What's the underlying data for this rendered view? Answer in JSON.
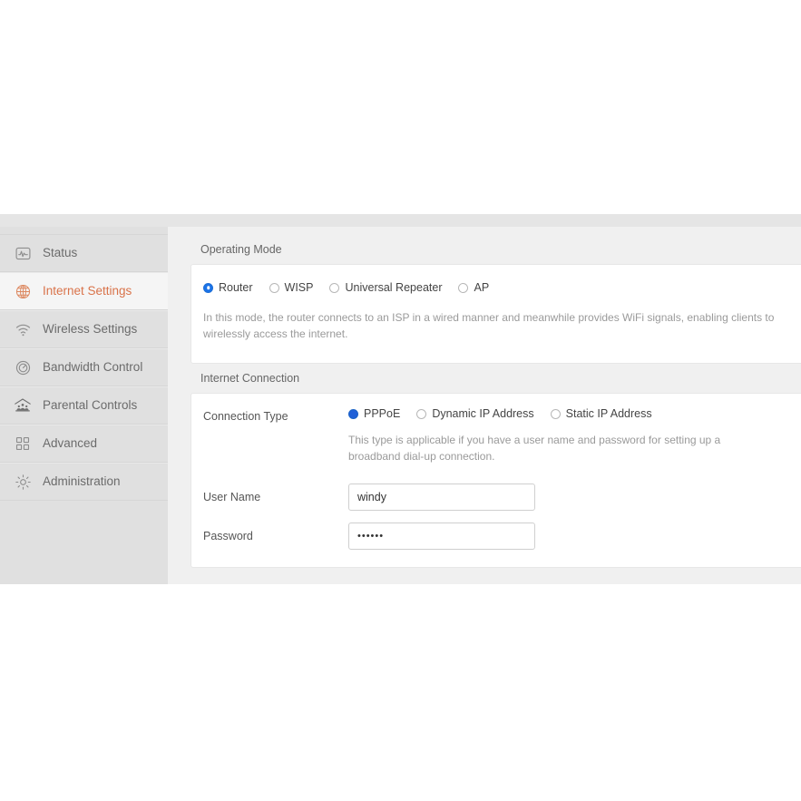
{
  "sidebar": {
    "items": [
      {
        "label": "Status",
        "icon": "status-monitor-icon",
        "active": false
      },
      {
        "label": "Internet Settings",
        "icon": "globe-icon",
        "active": true
      },
      {
        "label": "Wireless Settings",
        "icon": "wifi-icon",
        "active": false
      },
      {
        "label": "Bandwidth Control",
        "icon": "gauge-icon",
        "active": false
      },
      {
        "label": "Parental Controls",
        "icon": "family-house-icon",
        "active": false
      },
      {
        "label": "Advanced",
        "icon": "grid-squares-icon",
        "active": false
      },
      {
        "label": "Administration",
        "icon": "gear-icon",
        "active": false
      }
    ]
  },
  "operating_mode": {
    "title": "Operating Mode",
    "options": [
      {
        "label": "Router",
        "selected": true
      },
      {
        "label": "WISP",
        "selected": false
      },
      {
        "label": "Universal Repeater",
        "selected": false
      },
      {
        "label": "AP",
        "selected": false
      }
    ],
    "description": "In this mode, the router connects to an ISP in a wired manner and meanwhile provides WiFi signals, enabling clients to wirelessly access the internet."
  },
  "internet_connection": {
    "title": "Internet Connection",
    "connection_type_label": "Connection Type",
    "options": [
      {
        "label": "PPPoE",
        "selected": true
      },
      {
        "label": "Dynamic IP Address",
        "selected": false
      },
      {
        "label": "Static IP Address",
        "selected": false
      }
    ],
    "description": "This type is applicable if you have a user name and password for setting up a broadband dial-up connection.",
    "user_name_label": "User Name",
    "user_name_value": "windy",
    "user_name_placeholder": "",
    "password_label": "Password",
    "password_value": "••••••",
    "password_placeholder": ""
  },
  "colors": {
    "accent": "#d9734a",
    "radio_selected": "#2060d8",
    "sidebar_bg": "#e0e0e0",
    "content_bg": "#f0f0f0"
  }
}
